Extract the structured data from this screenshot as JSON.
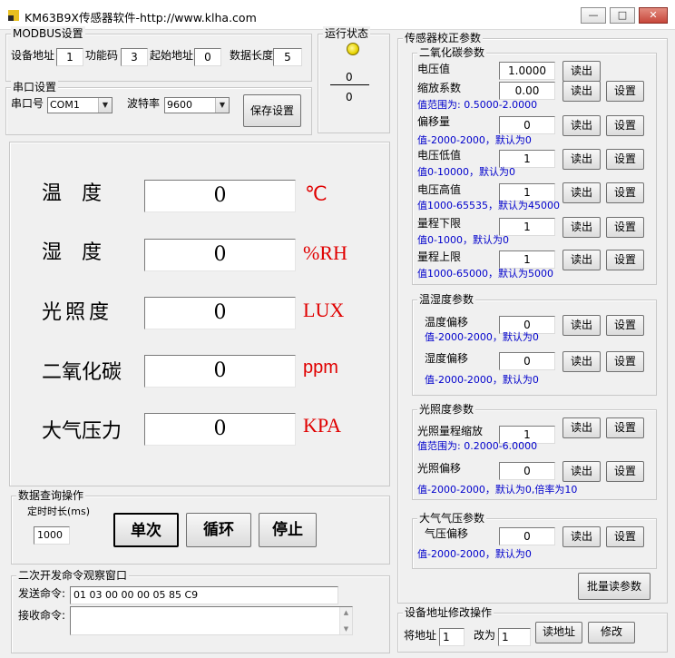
{
  "window": {
    "title": "KM63B9X传感器软件-http://www.klha.com"
  },
  "modbus": {
    "title": "MODBUS设置",
    "device_addr_label": "设备地址",
    "device_addr": "1",
    "func_label": "功能码",
    "func": "3",
    "start_addr_label": "起始地址",
    "start_addr": "0",
    "data_len_label": "数据长度",
    "data_len": "5"
  },
  "run_status": {
    "title": "运行状态",
    "value_top": "0",
    "value_bottom": "0"
  },
  "serial": {
    "title": "串口设置",
    "port_label": "串口号",
    "port": "COM1",
    "baud_label": "波特率",
    "baud": "9600",
    "save_label": "保存设置"
  },
  "display": {
    "temp_label": "温　度",
    "temp_value": "0",
    "temp_unit": "℃",
    "hum_label": "湿　度",
    "hum_value": "0",
    "hum_unit": "%RH",
    "light_label": "光照度",
    "light_value": "0",
    "light_unit": "LUX",
    "co2_label": "二氧化碳",
    "co2_value": "0",
    "co2_unit": "ppm",
    "press_label": "大气压力",
    "press_value": "0",
    "press_unit": "KPA"
  },
  "query": {
    "title": "数据查询操作",
    "timer_label": "定时时长(ms)",
    "timer": "1000",
    "single": "单次",
    "loop": "循环",
    "stop": "停止"
  },
  "dev_window": {
    "title": "二次开发命令观察窗口",
    "send_label": "发送命令:",
    "send_value": "01 03 00 00 00 05 85 C9",
    "recv_label": "接收命令:",
    "recv_value": ""
  },
  "calib": {
    "title": "传感器校正参数",
    "co2": {
      "title": "二氧化碳参数",
      "voltage_label": "电压值",
      "voltage": "1.0000",
      "scale_label": "缩放系数",
      "scale": "0.00",
      "scale_hint": "值范围为: 0.5000-2.0000",
      "offset_label": "偏移量",
      "offset": "0",
      "offset_hint": "值-2000-2000，默认为0",
      "vlow_label": "电压低值",
      "vlow": "1",
      "vlow_hint": "值0-10000，默认为0",
      "vhigh_label": "电压高值",
      "vhigh": "1",
      "vhigh_hint": "值1000-65535，默认为45000",
      "rlow_label": "量程下限",
      "rlow": "1",
      "rlow_hint": "值0-1000，默认为0",
      "rhigh_label": "量程上限",
      "rhigh": "1",
      "rhigh_hint": "值1000-65000，默认为5000"
    },
    "th": {
      "title": "温湿度参数",
      "temp_off_label": "温度偏移",
      "temp_off": "0",
      "temp_hint": "值-2000-2000，默认为0",
      "hum_off_label": "湿度偏移",
      "hum_off": "0",
      "hum_hint": "值-2000-2000，默认为0"
    },
    "light": {
      "title": "光照度参数",
      "scale_label": "光照量程缩放",
      "scale": "1",
      "scale_hint": "值范围为: 0.2000-6.0000",
      "off_label": "光照偏移",
      "off": "0",
      "off_hint": "值-2000-2000，默认为0,倍率为10"
    },
    "air": {
      "title": "大气气压参数",
      "off_label": "气压偏移",
      "off": "0",
      "off_hint": "值-2000-2000，默认为0"
    },
    "read_label": "读出",
    "set_label": "设置",
    "batch_read": "批量读参数"
  },
  "addr_change": {
    "title": "设备地址修改操作",
    "from_label": "将地址",
    "from": "1",
    "to_label": "改为",
    "to": "1",
    "read_addr": "读地址",
    "modify": "修改"
  },
  "colors": {
    "unit_red": "#e00000",
    "hint_blue": "#0000cc",
    "led_yellow": "#e8d400"
  },
  "icons": {
    "app": "app-icon",
    "minimize": "minimize-icon",
    "maximize": "maximize-icon",
    "close": "close-icon"
  }
}
